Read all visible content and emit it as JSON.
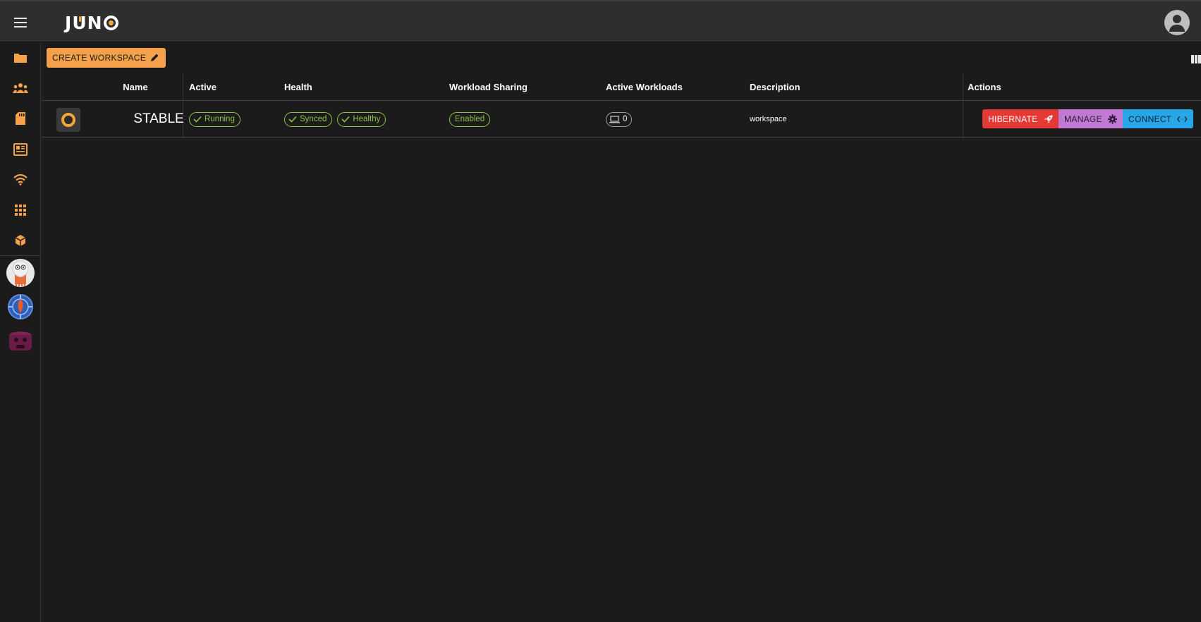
{
  "app": {
    "logo_text": "JUNO"
  },
  "toolbar": {
    "create_label": "CREATE WORKSPACE"
  },
  "sidebar": {
    "items": [
      "folder-icon",
      "groups-icon",
      "sd-card-icon",
      "news-icon",
      "wifi-icon",
      "apps-grid-icon",
      "package-icon"
    ],
    "apps": [
      "argo-app",
      "spinnaker-app",
      "secrets-app"
    ]
  },
  "table": {
    "headers": [
      "Name",
      "Active",
      "Health",
      "Workload Sharing",
      "Active Workloads",
      "Description",
      "Actions"
    ],
    "rows": [
      {
        "name": "STABLE",
        "active": "Running",
        "health": [
          "Synced",
          "Healthy"
        ],
        "sharing": "Enabled",
        "workloads": "0",
        "description": "workspace",
        "actions": {
          "hibernate": "HIBERNATE",
          "manage": "MANAGE",
          "connect": "CONNECT"
        }
      }
    ]
  },
  "colors": {
    "accent": "#f5a04a",
    "success": "#8bc34a",
    "hibernate": "#e53935",
    "manage": "#c07ad4",
    "connect": "#29a6e8"
  }
}
